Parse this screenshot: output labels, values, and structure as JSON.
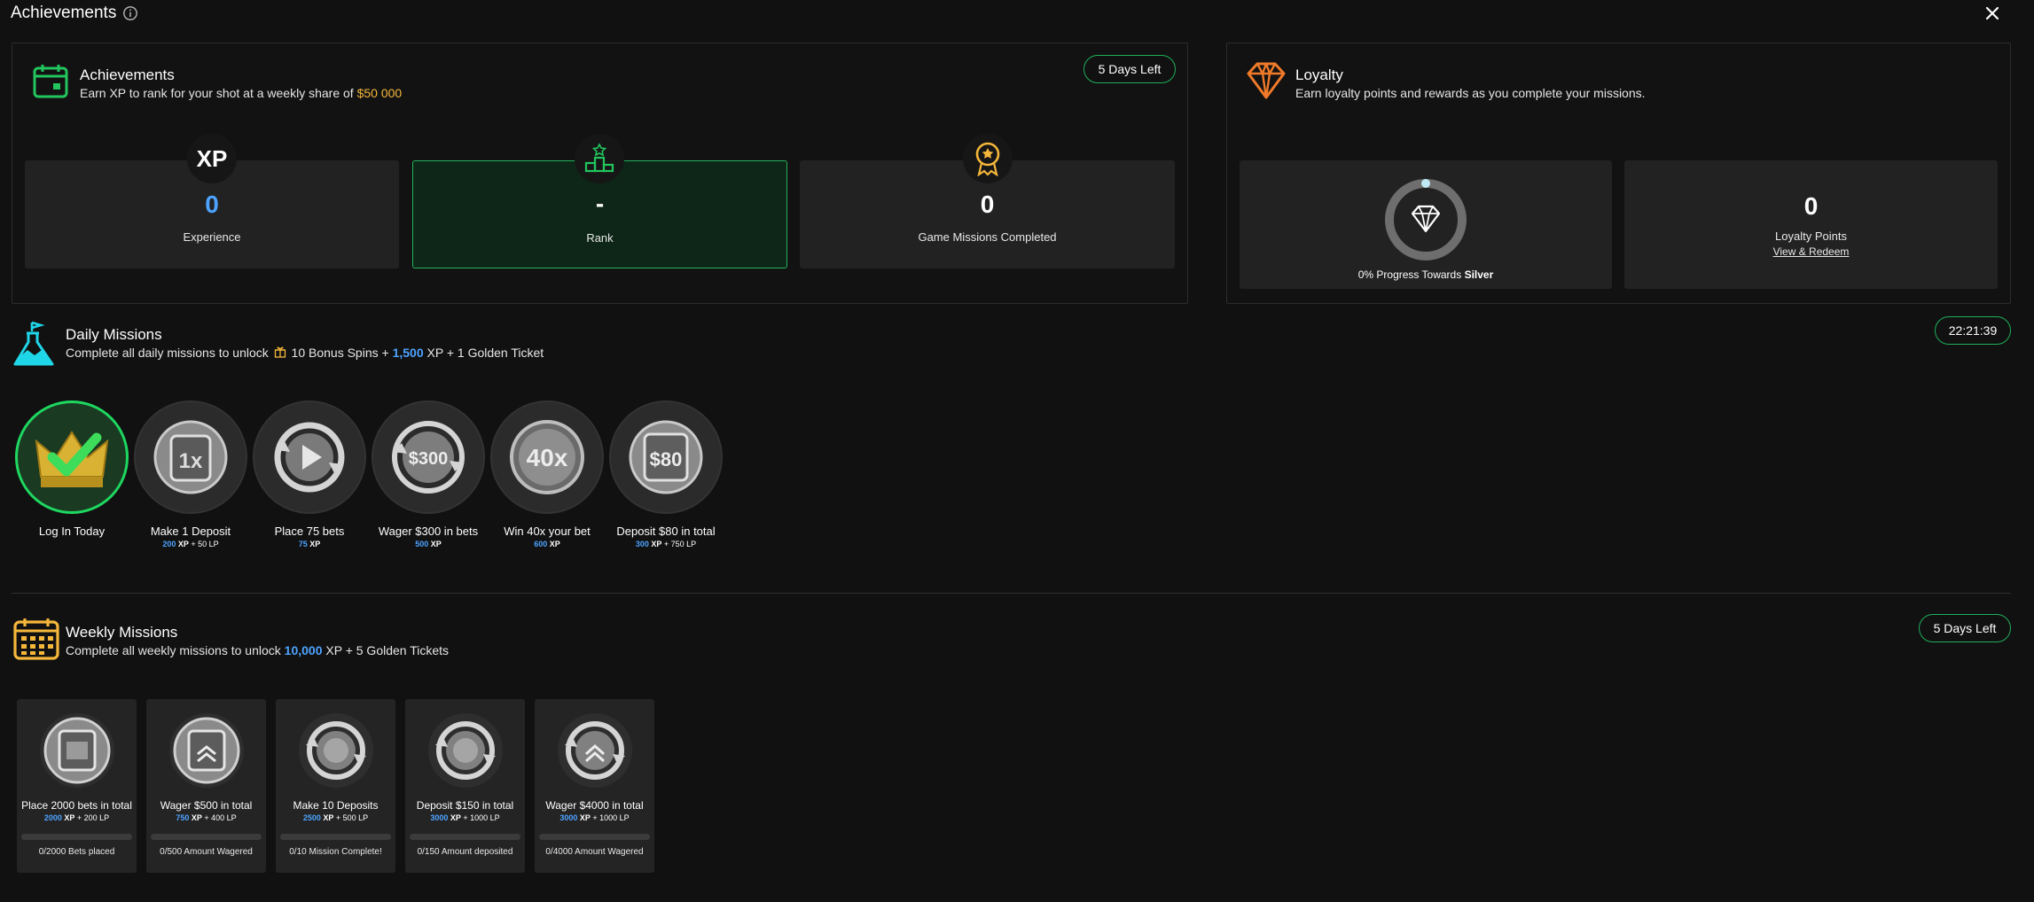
{
  "header": {
    "title": "Achievements"
  },
  "achievements": {
    "title": "Achievements",
    "subtitle_pre": "Earn XP to rank for your shot at a weekly share of",
    "prize": "$50 000",
    "timer": "5 Days Left",
    "stats": [
      {
        "value": "0",
        "label": "Experience",
        "badge": "XP"
      },
      {
        "value": "-",
        "label": "Rank"
      },
      {
        "value": "0",
        "label": "Game Missions Completed"
      }
    ]
  },
  "loyalty": {
    "title": "Loyalty",
    "subtitle": "Earn loyalty points and rewards as you complete your missions.",
    "progress_pre": "0% Progress Towards",
    "progress_tier": "Silver",
    "progress": 0,
    "points_value": "0",
    "points_label": "Loyalty Points",
    "link": "View & Redeem"
  },
  "daily": {
    "title": "Daily Missions",
    "sub_pre": "Complete all daily missions to unlock",
    "sub_mid": "10 Bonus Spins +",
    "xp": "1,500",
    "sub_post": "XP + 1 Golden Ticket",
    "timer": "22:21:39",
    "missions": [
      {
        "label": "Log In Today",
        "icon": "crown-check-icon",
        "text": "",
        "xp": "",
        "lp": ""
      },
      {
        "label": "Make 1 Deposit",
        "icon": "slot-1x-icon",
        "text": "1x",
        "xp": "200",
        "lp": "+ 50 LP"
      },
      {
        "label": "Place 75 bets",
        "icon": "play-refresh-icon",
        "text": "",
        "xp": "75",
        "lp": ""
      },
      {
        "label": "Wager $300 in bets",
        "icon": "coin-300-icon",
        "text": "$300",
        "xp": "500",
        "lp": ""
      },
      {
        "label": "Win 40x your bet",
        "icon": "multiplier-40x-icon",
        "text": "40x",
        "xp": "600",
        "lp": ""
      },
      {
        "label": "Deposit $80 in total",
        "icon": "slot-80-icon",
        "text": "$80",
        "xp": "300",
        "lp": "+ 750 LP"
      }
    ],
    "xp_unit": "XP"
  },
  "weekly": {
    "title": "Weekly Missions",
    "sub_pre": "Complete all weekly missions to unlock",
    "xp": "10,000",
    "sub_post": "XP + 5 Golden Tickets",
    "timer": "5 Days Left",
    "xp_unit": "XP",
    "missions": [
      {
        "label": "Place 2000 bets in total",
        "xp": "2000",
        "lp": "+ 200 LP",
        "progress": "0/2000 Bets placed",
        "icon": "slot-machine-icon",
        "fraction": 0
      },
      {
        "label": "Wager $500 in total",
        "xp": "750",
        "lp": "+ 400 LP",
        "progress": "0/500 Amount Wagered",
        "icon": "slot-chevron-icon",
        "fraction": 0
      },
      {
        "label": "Make 10 Deposits",
        "xp": "2500",
        "lp": "+ 500 LP",
        "progress": "0/10 Mission Complete!",
        "icon": "refresh-coin-icon",
        "fraction": 0
      },
      {
        "label": "Deposit $150 in total",
        "xp": "3000",
        "lp": "+ 1000 LP",
        "progress": "0/150 Amount deposited",
        "icon": "refresh-coin-icon",
        "fraction": 0
      },
      {
        "label": "Wager $4000 in total",
        "xp": "3000",
        "lp": "+ 1000 LP",
        "progress": "0/4000 Amount Wagered",
        "icon": "refresh-chevron-icon",
        "fraction": 0
      }
    ]
  },
  "colors": {
    "accent_green": "#1ed760",
    "xp_blue": "#4da3ff",
    "gold": "#f5b73b",
    "loyalty_orange": "#f07a2a",
    "daily_cyan": "#1fd6e8"
  }
}
